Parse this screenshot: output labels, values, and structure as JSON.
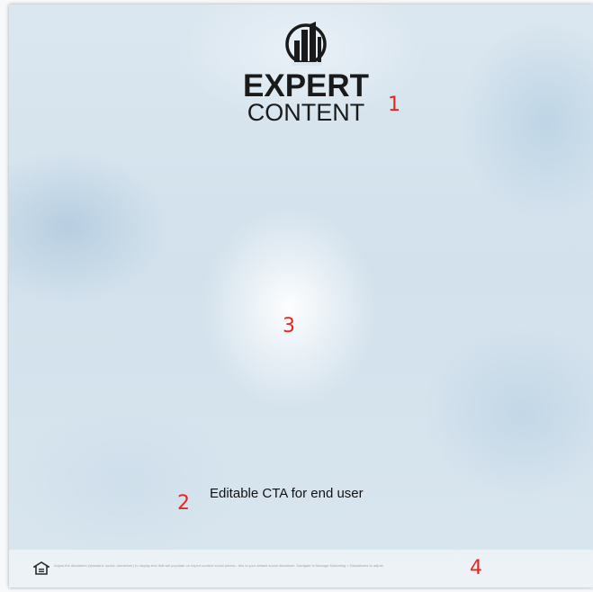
{
  "logo": {
    "line1": "EXPERT",
    "line2": "CONTENT"
  },
  "markers": {
    "logo": "1",
    "cta": "2",
    "background": "3",
    "footer": "4"
  },
  "cta": {
    "text": "Editable CTA for end user"
  },
  "footer": {
    "icon": "equal-housing-opportunity-icon",
    "disclaimer": "Adjust the disclaimer (standard, social, disclaimer) to display text that will populate on expert content social pieces - this is your default social disclaimer. Navigate to Manage Marketing > Disclaimers to adjust."
  },
  "colors": {
    "marker": "#e8251f",
    "logo": "#1a1a1a",
    "cta": "#111111"
  }
}
